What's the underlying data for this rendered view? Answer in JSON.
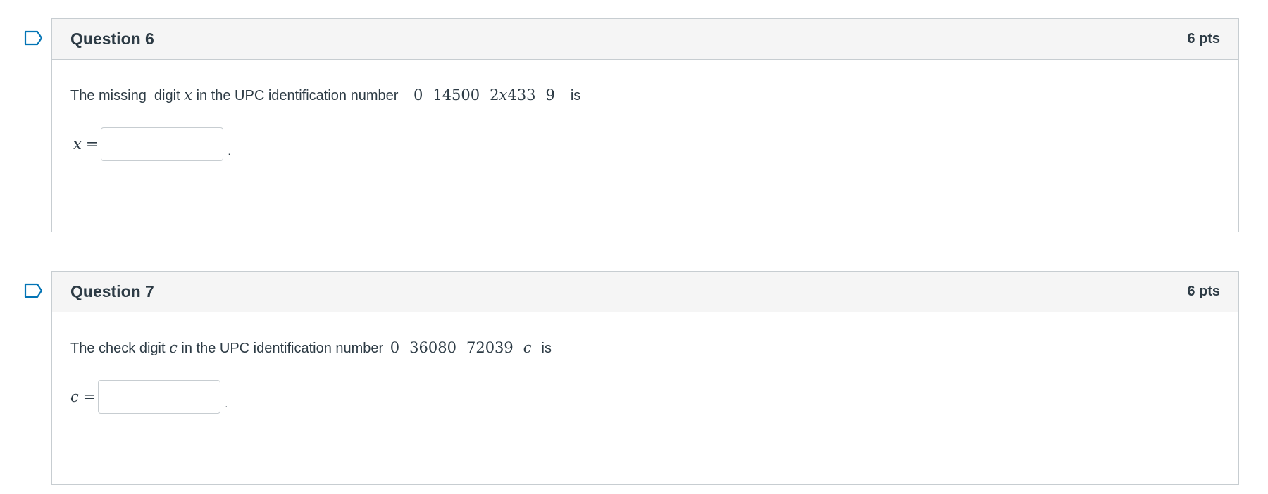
{
  "questions": [
    {
      "title": "Question 6",
      "points": "6 pts",
      "prompt_text_1": "The missing  digit ",
      "var": "x",
      "prompt_text_2": " in the UPC identification number ",
      "upc_part1": "0",
      "upc_part2": "14500",
      "upc_part3_prefix": "2",
      "upc_part3_var": "x",
      "upc_part3_suffix": "433",
      "upc_part4": "9",
      "prompt_text_3": "is",
      "answer_var": "x",
      "answer_eq": "=",
      "answer_value": "",
      "answer_placeholder": "",
      "period": "."
    },
    {
      "title": "Question 7",
      "points": "6 pts",
      "prompt_text_1": "The check digit ",
      "var": "c",
      "prompt_text_2": " in the UPC identification number ",
      "upc_part1": "0",
      "upc_part2": "36080",
      "upc_part3": "72039",
      "upc_part4_var": "c",
      "prompt_text_3": "is",
      "answer_var": "c",
      "answer_eq": "=",
      "answer_value": "",
      "answer_placeholder": "",
      "period": "."
    }
  ],
  "icons": {
    "flag": "flag-icon"
  },
  "colors": {
    "header_bg": "#f5f5f5",
    "border": "#c7cdd1",
    "text": "#2d3b45",
    "flag_stroke": "#0374b5"
  }
}
